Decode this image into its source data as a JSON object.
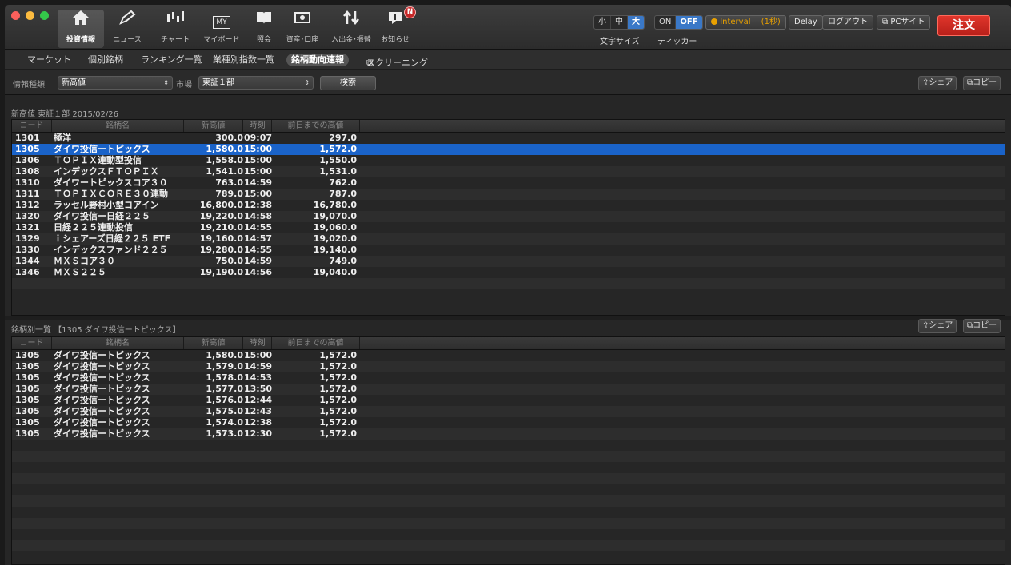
{
  "toolbar": {
    "tools": [
      {
        "label": "投資情報",
        "icon": "house-icon"
      },
      {
        "label": "ニュース",
        "icon": "pen-icon"
      },
      {
        "label": "チャート",
        "icon": "candlestick-icon"
      },
      {
        "label": "マイボード",
        "icon": "my-board-icon"
      },
      {
        "label": "照会",
        "icon": "book-icon"
      },
      {
        "label": "資産･口座",
        "icon": "money-icon"
      },
      {
        "label": "入出金･振替",
        "icon": "transfer-arrows-icon"
      },
      {
        "label": "お知らせ",
        "icon": "notice-icon"
      }
    ],
    "my_icon_text": "MY",
    "notice_badge": "N",
    "font_size": {
      "options": [
        "小",
        "中",
        "大"
      ],
      "selected": "大",
      "label": "文字サイズ"
    },
    "ticker": {
      "options": [
        "ON",
        "OFF"
      ],
      "selected": "OFF",
      "label": "ティッカー"
    },
    "interval_label": "Interval",
    "interval_value": "(1秒)",
    "delay_label": "Delay",
    "logout_label": "ログアウト",
    "pc_site_label": "PCサイト",
    "order_label": "注文"
  },
  "nav": {
    "items": [
      "マーケット",
      "個別銘柄",
      "ランキング一覧",
      "業種別指数一覧",
      "銘柄動向速報",
      "スクリーニング"
    ],
    "active": "銘柄動向速報"
  },
  "filter": {
    "info_type_label": "情報種類",
    "info_type_value": "新高値",
    "market_label": "市場",
    "market_value": "東証１部",
    "search_label": "検索",
    "share_label": "シェア",
    "copy_label": "コピー"
  },
  "top_panel": {
    "title": "新高値  東証１部  2015/02/26",
    "columns": [
      "コード",
      "銘柄名",
      "新高値",
      "時刻",
      "前日までの高値"
    ],
    "selected_index": 1,
    "rows": [
      [
        "1301",
        "極洋",
        "300.0",
        "09:07",
        "297.0"
      ],
      [
        "1305",
        "ダイワ投信ートピックス",
        "1,580.0",
        "15:00",
        "1,572.0"
      ],
      [
        "1306",
        "ＴＯＰＩＸ連動型投信",
        "1,558.0",
        "15:00",
        "1,550.0"
      ],
      [
        "1308",
        "インデックスＦＴＯＰＩＸ",
        "1,541.0",
        "15:00",
        "1,531.0"
      ],
      [
        "1310",
        "ダイワートピックスコア３０",
        "763.0",
        "14:59",
        "762.0"
      ],
      [
        "1311",
        "ＴＯＰＩＸＣＯＲＥ３０連動",
        "789.0",
        "15:00",
        "787.0"
      ],
      [
        "1312",
        "ラッセル野村小型コアイン",
        "16,800.0",
        "12:38",
        "16,780.0"
      ],
      [
        "1320",
        "ダイワ投信ー日経２２５",
        "19,220.0",
        "14:58",
        "19,070.0"
      ],
      [
        "1321",
        "日経２２５連動投信",
        "19,210.0",
        "14:55",
        "19,060.0"
      ],
      [
        "1329",
        "ｉシェアーズ日経２２５ ETF",
        "19,160.0",
        "14:57",
        "19,020.0"
      ],
      [
        "1330",
        "インデックスファンド２２５",
        "19,280.0",
        "14:55",
        "19,140.0"
      ],
      [
        "1344",
        "ＭＸＳコア３０",
        "750.0",
        "14:59",
        "749.0"
      ],
      [
        "1346",
        "ＭＸＳ２２５",
        "19,190.0",
        "14:56",
        "19,040.0"
      ]
    ]
  },
  "bottom_panel": {
    "title": "銘柄別一覧  【1305 ダイワ投信ートピックス】",
    "columns": [
      "コード",
      "銘柄名",
      "新高値",
      "時刻",
      "前日までの高値"
    ],
    "rows": [
      [
        "1305",
        "ダイワ投信ートピックス",
        "1,580.0",
        "15:00",
        "1,572.0"
      ],
      [
        "1305",
        "ダイワ投信ートピックス",
        "1,579.0",
        "14:59",
        "1,572.0"
      ],
      [
        "1305",
        "ダイワ投信ートピックス",
        "1,578.0",
        "14:53",
        "1,572.0"
      ],
      [
        "1305",
        "ダイワ投信ートピックス",
        "1,577.0",
        "13:50",
        "1,572.0"
      ],
      [
        "1305",
        "ダイワ投信ートピックス",
        "1,576.0",
        "12:44",
        "1,572.0"
      ],
      [
        "1305",
        "ダイワ投信ートピックス",
        "1,575.0",
        "12:43",
        "1,572.0"
      ],
      [
        "1305",
        "ダイワ投信ートピックス",
        "1,574.0",
        "12:38",
        "1,572.0"
      ],
      [
        "1305",
        "ダイワ投信ートピックス",
        "1,573.0",
        "12:30",
        "1,572.0"
      ]
    ]
  },
  "colors": {
    "selection": "#1a63c9",
    "order_button": "#d42c22",
    "toggle_on": "#3a78c7",
    "interval_dot": "#e8a000"
  }
}
